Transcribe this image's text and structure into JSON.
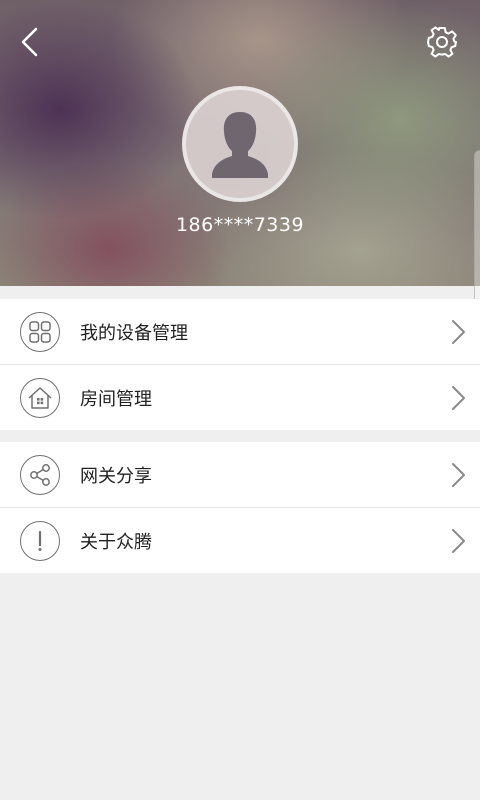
{
  "header": {
    "back_icon": "chevron-left-icon",
    "settings_icon": "gear-icon",
    "avatar_icon": "user-silhouette-icon",
    "phone": "186****7339"
  },
  "menu_groups": [
    {
      "items": [
        {
          "label": "我的设备管理",
          "icon": "grid-icon"
        },
        {
          "label": "房间管理",
          "icon": "house-icon"
        }
      ]
    },
    {
      "items": [
        {
          "label": "网关分享",
          "icon": "share-icon"
        },
        {
          "label": "关于众腾",
          "icon": "exclamation-icon"
        }
      ]
    }
  ],
  "colors": {
    "background": "#efefef",
    "row_background": "#ffffff",
    "icon_stroke": "#707070",
    "text": "#222222",
    "chevron": "#8a8a8a"
  }
}
